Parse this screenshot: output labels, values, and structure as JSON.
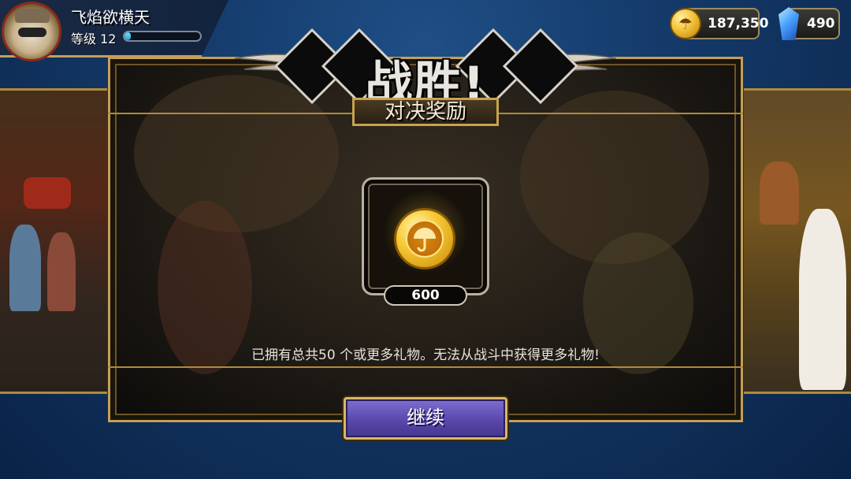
{
  "player": {
    "name": "飞焰欲横天",
    "level_label": "等级",
    "level": "12",
    "xp_progress": 0.08
  },
  "currencies": {
    "coins": "187,350",
    "gems": "490"
  },
  "header": {
    "title": "战胜!",
    "subtitle": "对决奖励"
  },
  "reward": {
    "icon": "umbrella-coin-icon",
    "amount": "600"
  },
  "message": "已拥有总共50  个或更多礼物。无法从战斗中获得更多礼物!",
  "continue_button": {
    "label": "继续"
  },
  "colors": {
    "gold_border": "#c4a055",
    "button_purple": "#5a48ac",
    "background_blue": "#143a6a"
  }
}
